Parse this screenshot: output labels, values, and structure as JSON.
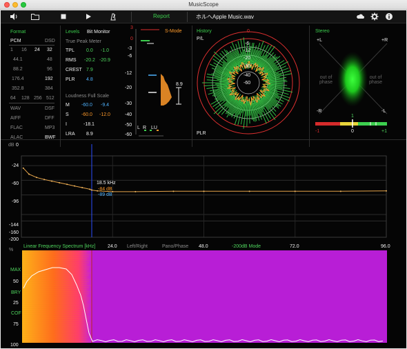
{
  "window": {
    "title": "MusicScope"
  },
  "toolbar": {
    "report_label": "Report",
    "filename": "ホルへApple Music.wav"
  },
  "format": {
    "title": "Format",
    "pcm_label": "PCM",
    "dsd_label": "DSD",
    "bit_depths": [
      "1",
      "16",
      "24",
      "32"
    ],
    "rates_pcm": [
      "44.1",
      "88.2",
      "176.4",
      "352.8",
      "64",
      "128",
      "256",
      "512"
    ],
    "rates_dsd": [
      "48",
      "96",
      "192",
      "384"
    ],
    "formats_left": [
      "WAV",
      "AIFF",
      "FLAC",
      "ALAC"
    ],
    "formats_right": [
      "DSF",
      "DFF",
      "MP3",
      "BWF"
    ]
  },
  "levels": {
    "title": "Levels",
    "bit_monitor": "Bit Monitor",
    "true_peak_meter": "True Peak Meter",
    "rows": [
      {
        "label": "TPL",
        "left": "0.0",
        "right": "-1.0"
      },
      {
        "label": "RMS",
        "left": "-20.2",
        "right": "-20.9"
      },
      {
        "label": "CREST",
        "left": "7.9",
        "right": ""
      },
      {
        "label": "PLR",
        "left": "4.8",
        "right": ""
      }
    ],
    "loudness_title": "Loudness Full Scale",
    "loudness": [
      {
        "label": "M",
        "a": "-60.0",
        "b": "-9.4"
      },
      {
        "label": "S",
        "a": "-60.0",
        "b": "-12.0"
      },
      {
        "label": "I",
        "a": "-18.1",
        "b": ""
      },
      {
        "label": "LRA",
        "a": "8.9",
        "b": ""
      }
    ]
  },
  "smode": {
    "title": "S-Mode",
    "scale": [
      "3",
      "0",
      "-3",
      "-6",
      "-12",
      "-20",
      "-30",
      "-40",
      "-50",
      "-60"
    ],
    "marker_value": "8.9",
    "legend": [
      "L",
      "R",
      "LU"
    ]
  },
  "history": {
    "title": "History",
    "top_label": "P/L",
    "bottom_label": "PLR",
    "rings": [
      "-6",
      "-12",
      "-20",
      "-30",
      "-40",
      "-60"
    ],
    "zero_label": "0"
  },
  "stereo": {
    "title": "Stereo",
    "tl": "+L",
    "tr": "+R",
    "bl": "-R",
    "br": "-L",
    "left_phase": "out of\nphase",
    "right_phase": "out of\nphase",
    "balance_labels": [
      "-1",
      "0",
      "+1"
    ],
    "correlation_top": "1"
  },
  "spectrum": {
    "unit_label": "dB",
    "y_ticks": [
      "0",
      "-24",
      "-60",
      "-96",
      "-144",
      "-160",
      "-200"
    ],
    "x_ticks": [
      "24.0",
      "48.0",
      "72.0",
      "96.0"
    ],
    "cursor_freq": "18.5 kHz",
    "cursor_a": "-84 dB",
    "cursor_b": "-89 dB",
    "footer": {
      "linear": "Linear Frequency Spectrum [kHz]",
      "left_right": "Left/Right",
      "pano_phase": "Pano/Phase",
      "db_mode": "-200dB Mode"
    }
  },
  "spectrogram": {
    "percent_label": "%",
    "y_labels": [
      "MAX",
      "50",
      "BRY",
      "25",
      "COF",
      "75",
      "100"
    ]
  },
  "chart_data": {
    "type": "line",
    "title": "",
    "xlabel": "Linear Frequency Spectrum [kHz]",
    "ylabel": "dB",
    "xlim": [
      0,
      96
    ],
    "ylim": [
      -200,
      0
    ],
    "series": [
      {
        "name": "",
        "x": [
          0.5,
          2,
          4,
          6,
          8,
          10,
          12,
          14,
          16,
          18,
          18.5,
          20,
          24,
          30,
          40,
          48,
          60,
          72,
          84,
          96
        ],
        "y": [
          -30,
          -45,
          -53,
          -58,
          -62,
          -66,
          -70,
          -74,
          -78,
          -82,
          -84,
          -86,
          -88,
          -88,
          -87,
          -87,
          -87,
          -87,
          -87,
          -86
        ]
      }
    ]
  }
}
